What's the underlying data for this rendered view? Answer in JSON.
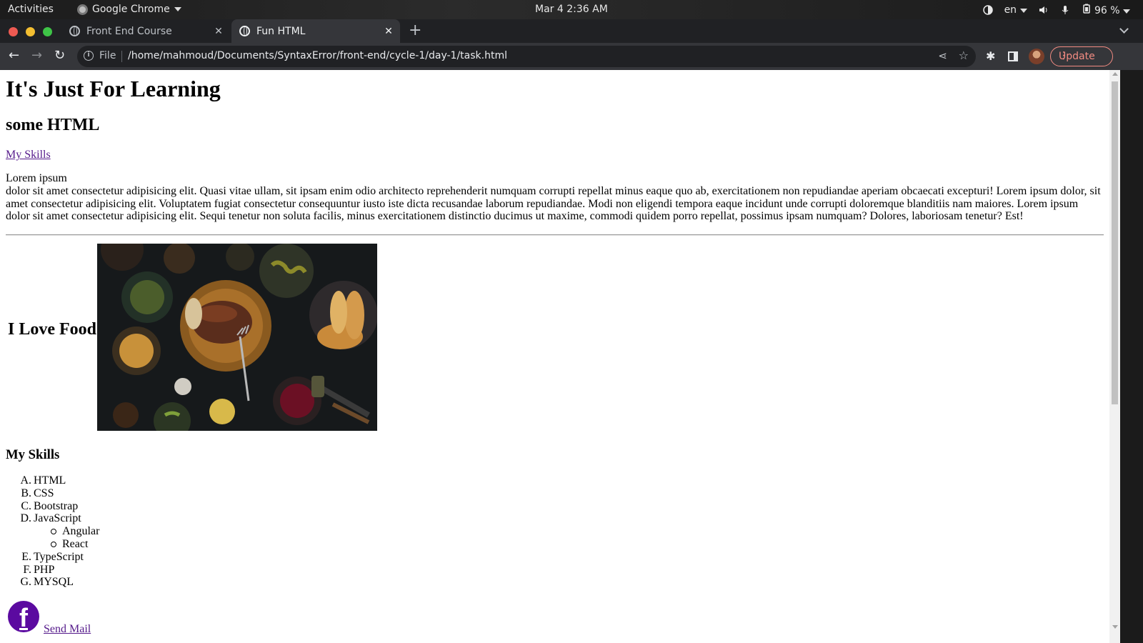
{
  "os_topbar": {
    "activities": "Activities",
    "app_name": "Google Chrome",
    "clock": "Mar 4  2:36 AM",
    "language": "en",
    "battery": "96 %"
  },
  "browser": {
    "tabs": [
      {
        "title": "Front End Course",
        "active": false
      },
      {
        "title": "Fun HTML",
        "active": true
      }
    ],
    "address": {
      "scheme_label": "File",
      "url": "/home/mahmoud/Documents/SyntaxError/front-end/cycle-1/day-1/task.html"
    },
    "update_label": "Update",
    "accent_color": "#f28b82"
  },
  "page": {
    "h1": "It's Just For Learning",
    "h2": "some HTML",
    "skills_link": "My Skills",
    "lorem_heading": "Lorem ipsum",
    "lorem_body": "dolor sit amet consectetur adipisicing elit. Quasi vitae ullam, sit ipsam enim odio architecto reprehenderit numquam corrupti repellat minus eaque quo ab, exercitationem non repudiandae aperiam obcaecati excepturi! Lorem ipsum dolor, sit amet consectetur adipisicing elit. Voluptatem fugiat consectetur consequuntur iusto iste dicta recusandae laborum repudiandae. Modi non eligendi tempora eaque incidunt unde corrupti doloremque blanditiis nam maiores. Lorem ipsum dolor sit amet consectetur adipisicing elit. Sequi tenetur non soluta facilis, minus exercitationem distinctio ducimus ut maxime, commodi quidem porro repellat, possimus ipsam numquam? Dolores, laboriosam tenetur? Est!",
    "food_label": "I Love Food",
    "skills_title": "My Skills",
    "skills": [
      {
        "marker": "A.",
        "label": "HTML"
      },
      {
        "marker": "B.",
        "label": "CSS"
      },
      {
        "marker": "C.",
        "label": "Bootstrap"
      },
      {
        "marker": "D.",
        "label": "JavaScript",
        "children": [
          "Angular",
          "React"
        ]
      },
      {
        "marker": "E.",
        "label": "TypeScript"
      },
      {
        "marker": "F.",
        "label": "PHP"
      },
      {
        "marker": "G.",
        "label": "MYSQL"
      }
    ],
    "facebook_glyph": "f",
    "send_mail": "Send Mail",
    "link_color": "#551a8b"
  }
}
